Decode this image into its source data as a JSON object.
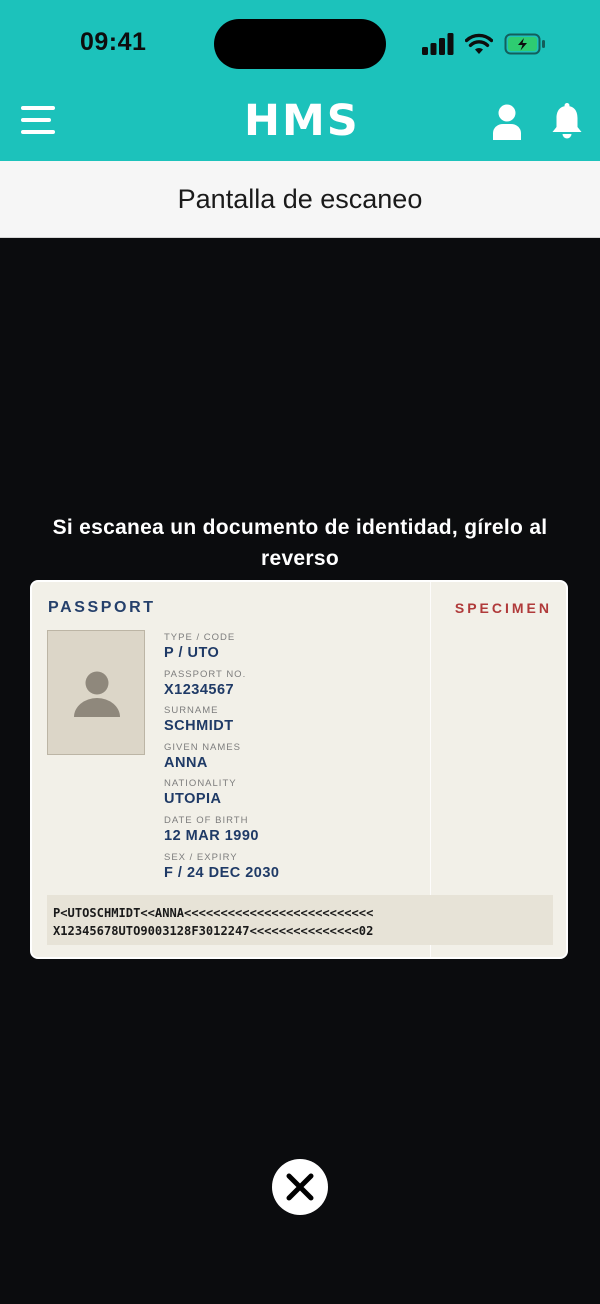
{
  "status_bar": {
    "time": "09:41"
  },
  "app_header": {
    "logo": "HMS"
  },
  "page": {
    "title": "Pantalla de escaneo"
  },
  "scanner": {
    "instruction": "Si escanea un documento de identidad, gírelo al reverso"
  },
  "passport": {
    "title": "PASSPORT",
    "watermark": "SPECIMEN",
    "fields": [
      {
        "label": "TYPE / CODE",
        "value": "P / UTO"
      },
      {
        "label": "PASSPORT NO.",
        "value": "X1234567"
      },
      {
        "label": "SURNAME",
        "value": "SCHMIDT"
      },
      {
        "label": "GIVEN NAMES",
        "value": "ANNA"
      },
      {
        "label": "NATIONALITY",
        "value": "UTOPIA"
      },
      {
        "label": "DATE OF BIRTH",
        "value": "12 MAR 1990"
      },
      {
        "label": "SEX / EXPIRY",
        "value": "F / 24 DEC 2030"
      }
    ],
    "mrz": [
      "P<UTOSCHMIDT<<ANNA<<<<<<<<<<<<<<<<<<<<<<<<<<",
      "X12345678UTO9003128F3012247<<<<<<<<<<<<<<<02"
    ]
  },
  "icons": {
    "menu": "hamburger-icon",
    "user": "user-icon",
    "notifications": "bell-icon",
    "close": "close-icon",
    "signal": "cellular-signal-icon",
    "wifi": "wifi-icon",
    "battery": "battery-charging-icon"
  },
  "colors": {
    "header": "#1cc2bb",
    "background": "#0b0c0e",
    "passport_text": "#1f3a66",
    "specimen": "#b03a3a",
    "battery": "#2ecc71"
  }
}
